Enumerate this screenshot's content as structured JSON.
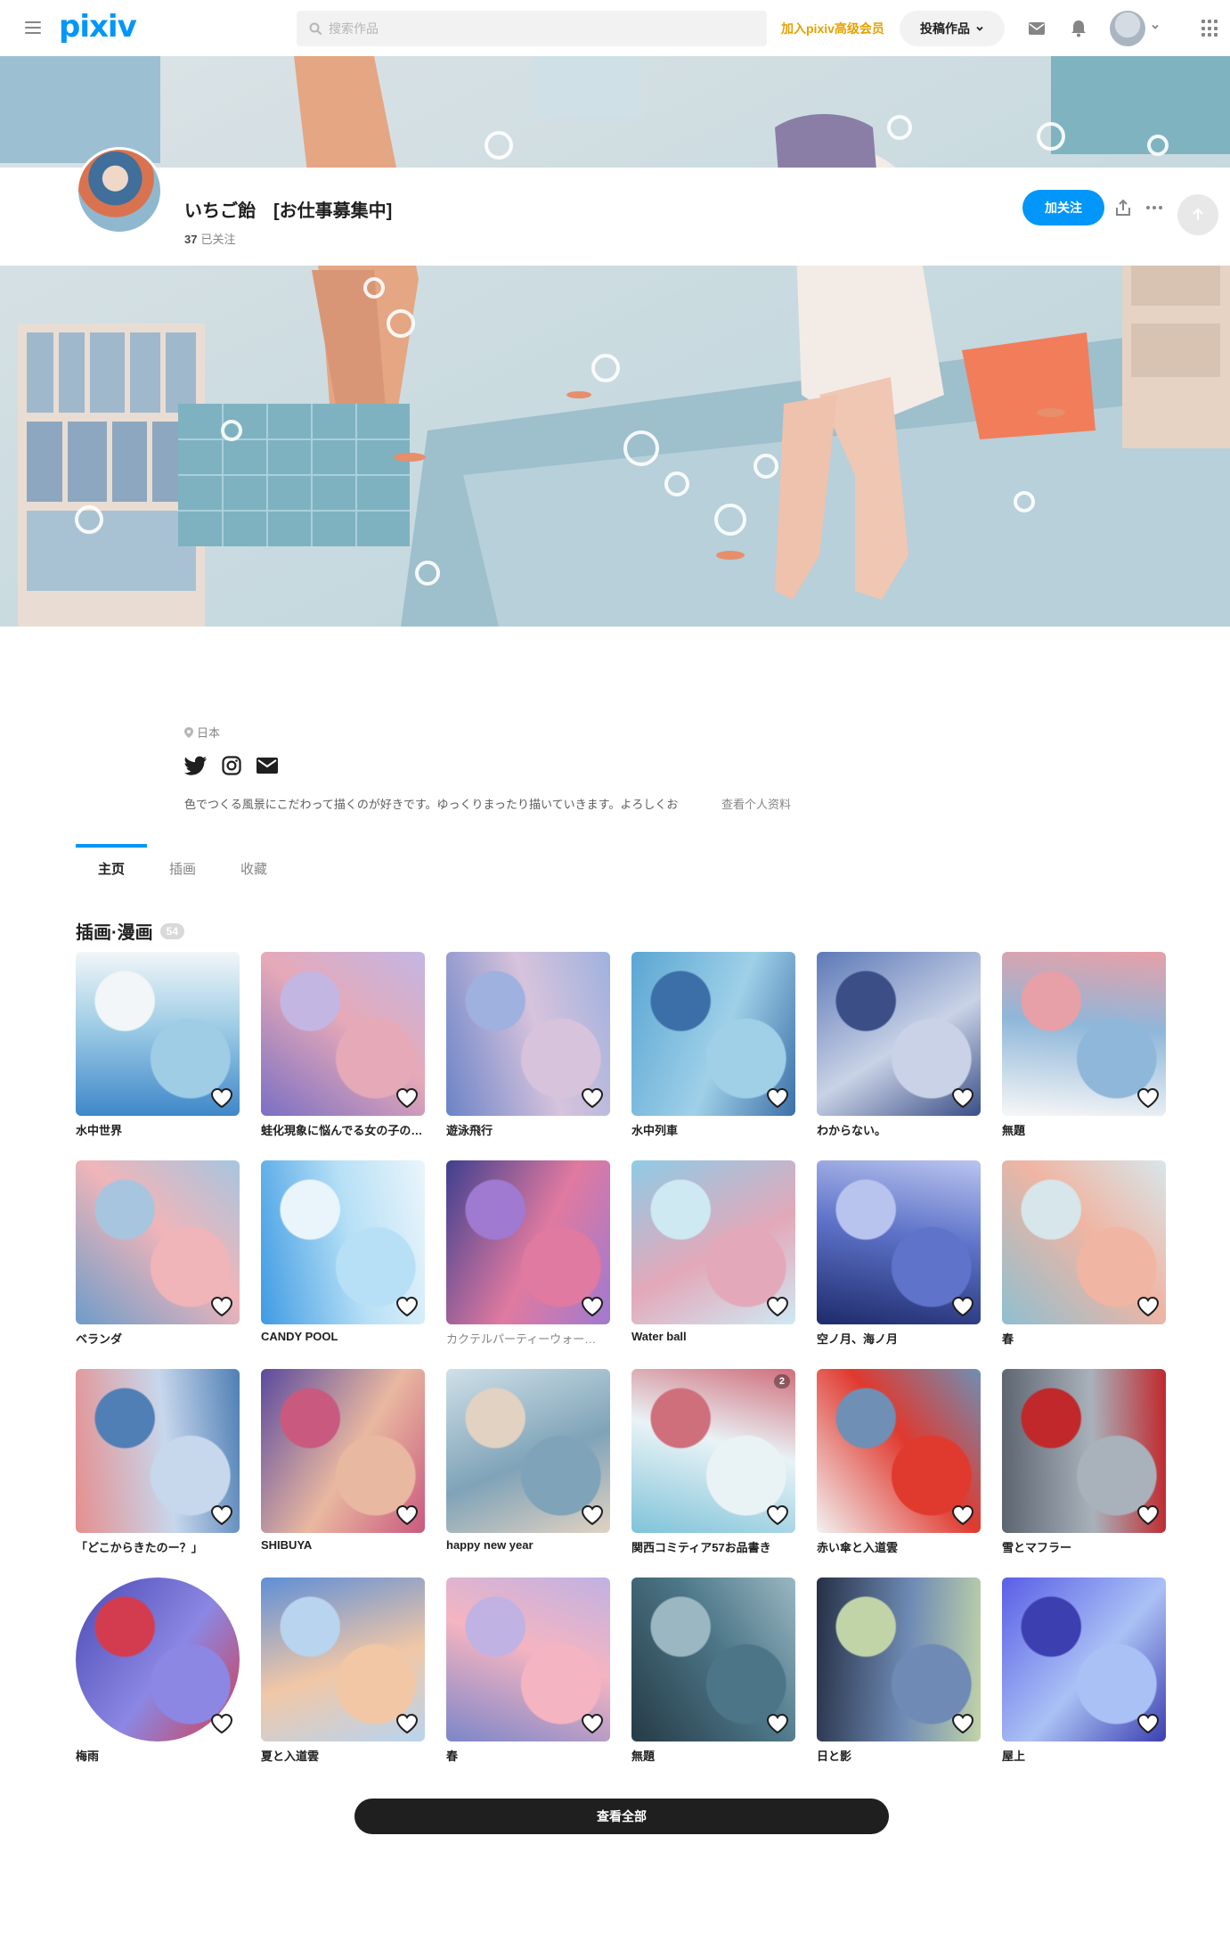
{
  "header": {
    "logo": "pixiv",
    "search_placeholder": "搜索作品",
    "premium_link": "加入pixiv高级会员",
    "post_button": "投稿作品"
  },
  "profile": {
    "name": "いちご飴　[お仕事募集中]",
    "following_count": "37",
    "following_label": "已关注",
    "follow_button": "加关注",
    "location": "日本",
    "bio": "色でつくる風景にこだわって描くのが好きです。ゆっくりまったり描いていきます。よろしくお",
    "bio_more": "查看个人资料"
  },
  "tabs": [
    {
      "label": "主页",
      "active": true
    },
    {
      "label": "插画",
      "active": false
    },
    {
      "label": "收藏",
      "active": false
    }
  ],
  "section": {
    "title": "插画·漫画",
    "count": "54"
  },
  "works": [
    {
      "title": "水中世界",
      "colors": [
        "#3f87c9",
        "#9fcde6",
        "#f2f6f8"
      ]
    },
    {
      "title": "蛙化現象に悩んでる女の子の…",
      "colors": [
        "#7b6fc4",
        "#e6a9b7",
        "#c3b6e3"
      ]
    },
    {
      "title": "遊泳飛行",
      "colors": [
        "#6b83c7",
        "#d7c3dc",
        "#9fb1de"
      ]
    },
    {
      "title": "水中列車",
      "colors": [
        "#5aa6d3",
        "#9fd0e8",
        "#3c6fa8"
      ]
    },
    {
      "title": "わからない。",
      "colors": [
        "#5d79b7",
        "#c9d2e6",
        "#3b4f86"
      ]
    },
    {
      "title": "無題",
      "colors": [
        "#f7f7f7",
        "#8fb7d9",
        "#e7a0a8"
      ]
    },
    {
      "title": "ベランダ",
      "colors": [
        "#6e9cc9",
        "#f0b5b9",
        "#a7c5df"
      ]
    },
    {
      "title": "CANDY POOL",
      "colors": [
        "#3f9be3",
        "#b7e0f6",
        "#eaf5fb"
      ]
    },
    {
      "title": "カクテルパーティーウォー…",
      "colors": [
        "#3f3f8f",
        "#e07aa0",
        "#9f7ad0"
      ],
      "muted": true
    },
    {
      "title": "Water ball",
      "colors": [
        "#8fcbe6",
        "#e3a8b9",
        "#cfe9f3"
      ]
    },
    {
      "title": "空ノ月、海ノ月",
      "colors": [
        "#1e2b6b",
        "#5e73c9",
        "#b9c4ee"
      ]
    },
    {
      "title": "春",
      "colors": [
        "#8fbfd0",
        "#f0b5a3",
        "#d7e6ea"
      ]
    },
    {
      "title": "「どこからきたのー？」",
      "colors": [
        "#e58f8f",
        "#c7d7ec",
        "#4f7fb5"
      ]
    },
    {
      "title": "SHIBUYA",
      "colors": [
        "#5b4a9e",
        "#e9b8a0",
        "#c9597f"
      ]
    },
    {
      "title": "happy new year",
      "colors": [
        "#cfe0e8",
        "#7fa3b8",
        "#e1d2c2"
      ]
    },
    {
      "title": "関西コミティア57お品書き",
      "colors": [
        "#7fc3d9",
        "#e9f3f6",
        "#d06f7c"
      ],
      "pages": "2"
    },
    {
      "title": "赤い傘と入道雲",
      "colors": [
        "#f2f2f2",
        "#e0392e",
        "#6f8fb5"
      ]
    },
    {
      "title": "雪とマフラー",
      "colors": [
        "#5c6470",
        "#a9b1bb",
        "#c0282c"
      ]
    },
    {
      "title": "梅雨",
      "colors": [
        "#4b4ab5",
        "#8b87e3",
        "#d33c4f"
      ],
      "round": true
    },
    {
      "title": "夏と入道雲",
      "colors": [
        "#5f8fd7",
        "#f1c7a6",
        "#b8d4ef"
      ]
    },
    {
      "title": "春",
      "colors": [
        "#7d86c9",
        "#f5b4c1",
        "#c0b2e3"
      ]
    },
    {
      "title": "無題",
      "colors": [
        "#263a46",
        "#4c7687",
        "#9ab7c2"
      ]
    },
    {
      "title": "日と影",
      "colors": [
        "#263046",
        "#6f8bb5",
        "#c1d4a8"
      ]
    },
    {
      "title": "屋上",
      "colors": [
        "#5a5ee6",
        "#aac1f5",
        "#3c3fb0"
      ]
    }
  ],
  "view_all": "查看全部",
  "colors": {
    "brand": "#0096fa",
    "premium": "#e6a100",
    "dark_button": "#1f1f1f"
  },
  "icons": [
    "menu-icon",
    "search-icon",
    "mail-icon",
    "bell-icon",
    "apps-icon",
    "share-icon",
    "more-icon",
    "upload-icon",
    "location-icon",
    "twitter-icon",
    "instagram-icon",
    "envelope-icon",
    "heart-icon"
  ]
}
